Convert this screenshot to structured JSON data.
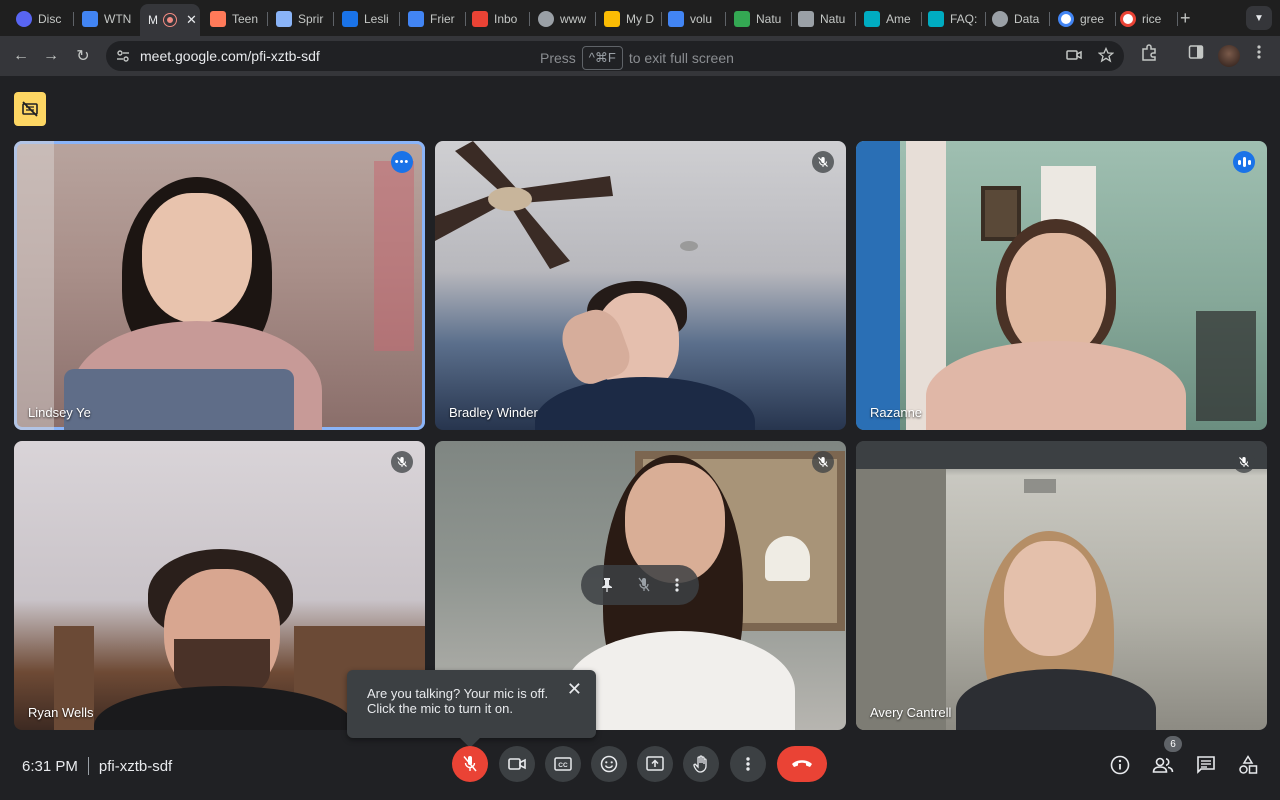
{
  "browser": {
    "tabs": [
      {
        "label": "Disc",
        "color": "#5865f2"
      },
      {
        "label": "WTN",
        "color": "#4285f4"
      },
      {
        "label": "M",
        "color": "#ea4335"
      },
      {
        "label": "Teen",
        "color": "#ff7a59"
      },
      {
        "label": "Sprir",
        "color": "#8ab4f8"
      },
      {
        "label": "Lesli",
        "color": "#1a73e8"
      },
      {
        "label": "Frier",
        "color": "#4285f4"
      },
      {
        "label": "Inbo",
        "color": "#ea4335"
      },
      {
        "label": "www",
        "color": "#9aa0a6"
      },
      {
        "label": "My D",
        "color": "#fbbc04"
      },
      {
        "label": "volu",
        "color": "#4285f4"
      },
      {
        "label": "Natu",
        "color": "#34a853"
      },
      {
        "label": "Natu",
        "color": "#9aa0a6"
      },
      {
        "label": "Ame",
        "color": "#00acc1"
      },
      {
        "label": "FAQ:",
        "color": "#00acc1"
      },
      {
        "label": "Data",
        "color": "#9aa0a6"
      },
      {
        "label": "gree",
        "color": "#4285f4"
      },
      {
        "label": "rice",
        "color": "#4285f4"
      }
    ],
    "active_tab_index": 2,
    "new_tab_symbol": "+",
    "url": "meet.google.com/pfi-xztb-sdf",
    "fullscreen_hint": {
      "press": "Press",
      "key": "^⌘F",
      "rest": "to exit full screen"
    }
  },
  "meeting": {
    "time": "6:31 PM",
    "code": "pfi-xztb-sdf",
    "participant_count": "6",
    "participants": [
      {
        "name": "Lindsey Ye",
        "status": "more-options"
      },
      {
        "name": "Bradley Winder",
        "status": "muted"
      },
      {
        "name": "Razanne",
        "status": "speaking"
      },
      {
        "name": "Ryan Wells",
        "status": "muted"
      },
      {
        "name": "",
        "status": "muted"
      },
      {
        "name": "Avery Cantrell",
        "status": "muted"
      }
    ],
    "toast": {
      "line1": "Are you talking? Your mic is off.",
      "line2": "Click the mic to turn it on.",
      "close": "✕"
    }
  },
  "colors": {
    "accent_blue": "#1a73e8",
    "end_call_red": "#ea4335",
    "effects_yellow": "#fdd663",
    "selected_outline": "#8ab4f8"
  }
}
